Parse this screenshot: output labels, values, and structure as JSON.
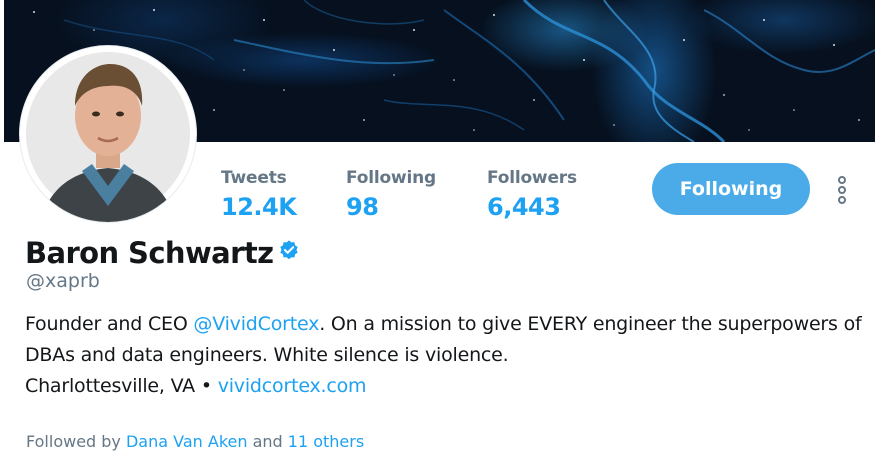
{
  "profile": {
    "name": "Baron Schwartz",
    "handle": "@xaprb",
    "bio_prefix": "Founder and CEO ",
    "bio_mention": "@VividCortex",
    "bio_suffix": ". On a mission to give EVERY engineer the superpowers of DBAs and data engineers. White silence is violence.",
    "location": "Charlottesville, VA",
    "separator": "•",
    "website": "vividcortex.com"
  },
  "stats": [
    {
      "label": "Tweets",
      "value": "12.4K"
    },
    {
      "label": "Following",
      "value": "98"
    },
    {
      "label": "Followers",
      "value": "6,443"
    }
  ],
  "actions": {
    "follow_label": "Following",
    "more_icon": "more-vertical-icon"
  },
  "followed_by": {
    "prefix": "Followed by ",
    "user": "Dana Van Aken",
    "connector": " and ",
    "others": "11 others"
  },
  "colors": {
    "accent": "#1da1f2",
    "button": "#4aabe8",
    "muted": "#657786",
    "text": "#14171a",
    "banner": "#06101e"
  },
  "icons": {
    "verified": "verified-badge-icon"
  }
}
